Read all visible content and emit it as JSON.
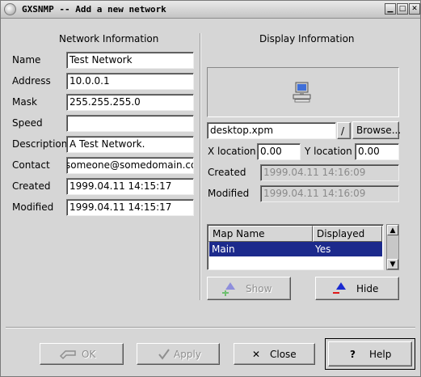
{
  "window": {
    "title": "GXSNMP -- Add a new network"
  },
  "network_info": {
    "heading": "Network Information",
    "fields": [
      {
        "label": "Name",
        "value": "Test Network"
      },
      {
        "label": "Address",
        "value": "10.0.0.1"
      },
      {
        "label": "Mask",
        "value": "255.255.255.0"
      },
      {
        "label": "Speed",
        "value": ""
      },
      {
        "label": "Description",
        "value": "A Test Network."
      },
      {
        "label": "Contact",
        "value": "someone@somedomain.com"
      },
      {
        "label": "Created",
        "value": "1999.04.11 14:15:17"
      },
      {
        "label": "Modified",
        "value": "1999.04.11 14:15:17"
      }
    ]
  },
  "display_info": {
    "heading": "Display Information",
    "pixmap": {
      "icon": "computer-icon",
      "file": "desktop.xpm",
      "dropdown": "/",
      "browse_label": "Browse..."
    },
    "x_location": {
      "label": "X location",
      "value": "0.00"
    },
    "y_location": {
      "label": "Y location",
      "value": "0.00"
    },
    "created": {
      "label": "Created",
      "value": "1999.04.11 14:16:09"
    },
    "modified": {
      "label": "Modified",
      "value": "1999.04.11 14:16:09"
    },
    "map_list": {
      "columns": [
        "Map Name",
        "Displayed"
      ],
      "rows": [
        {
          "map": "Main",
          "displayed": "Yes",
          "selected": true
        }
      ]
    },
    "show_label": "Show",
    "hide_label": "Hide"
  },
  "buttons": {
    "ok": "OK",
    "apply": "Apply",
    "close": "Close",
    "help": "Help"
  },
  "colors": {
    "selection": "#1c2a8c",
    "background": "#d6d6d6"
  }
}
